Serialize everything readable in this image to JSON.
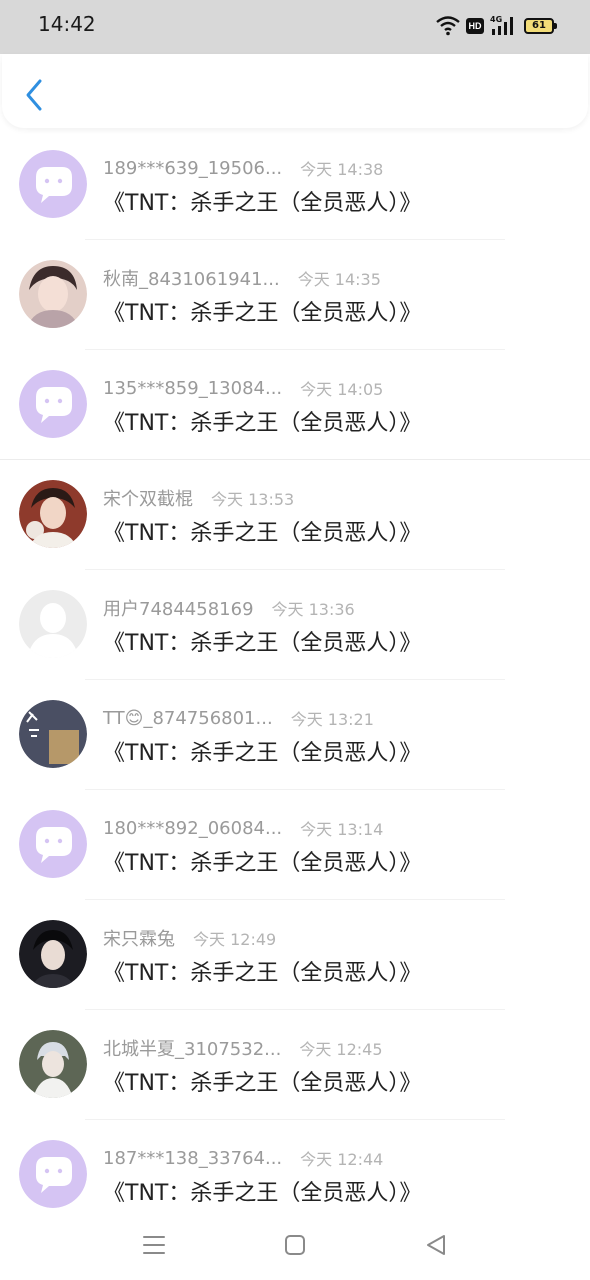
{
  "status_bar": {
    "time": "14:42",
    "hd_label": "HD",
    "net_label": "4G",
    "battery": "61"
  },
  "header": {
    "back_icon": "chevron-left-icon",
    "accent_color": "#2f8fe0"
  },
  "messages": [
    {
      "user": "189***639_19506...",
      "time": "今天 14:38",
      "text": "《TNT：杀手之王（全员恶人）》",
      "avatar": "default-chat-avatar"
    },
    {
      "user": "秋南_8431061941...",
      "time": "今天 14:35",
      "text": "《TNT：杀手之王（全员恶人）》",
      "avatar": "photo-avatar"
    },
    {
      "user": "135***859_13084...",
      "time": "今天 14:05",
      "text": "《TNT：杀手之王（全员恶人）》",
      "avatar": "default-chat-avatar"
    },
    {
      "user": "宋个双截棍",
      "time": "今天 13:53",
      "text": "《TNT：杀手之王（全员恶人）》",
      "avatar": "photo-avatar"
    },
    {
      "user": "用户7484458169",
      "time": "今天 13:36",
      "text": "《TNT：杀手之王（全员恶人）》",
      "avatar": "blank-person-avatar"
    },
    {
      "user": "TT😊_874756801...",
      "time": "今天 13:21",
      "text": "《TNT：杀手之王（全员恶人）》",
      "avatar": "photo-avatar"
    },
    {
      "user": "180***892_06084...",
      "time": "今天 13:14",
      "text": "《TNT：杀手之王（全员恶人）》",
      "avatar": "default-chat-avatar"
    },
    {
      "user": "宋只霖兔",
      "time": "今天 12:49",
      "text": "《TNT：杀手之王（全员恶人）》",
      "avatar": "photo-avatar"
    },
    {
      "user": "北城半夏_3107532...",
      "time": "今天 12:45",
      "text": "《TNT：杀手之王（全员恶人）》",
      "avatar": "photo-avatar"
    },
    {
      "user": "187***138_33764...",
      "time": "今天 12:44",
      "text": "《TNT：杀手之王（全员恶人）》",
      "avatar": "default-chat-avatar"
    }
  ],
  "nav_bar": {
    "menu_icon": "menu-icon",
    "home_icon": "home-square-icon",
    "back_icon": "back-triangle-icon"
  }
}
